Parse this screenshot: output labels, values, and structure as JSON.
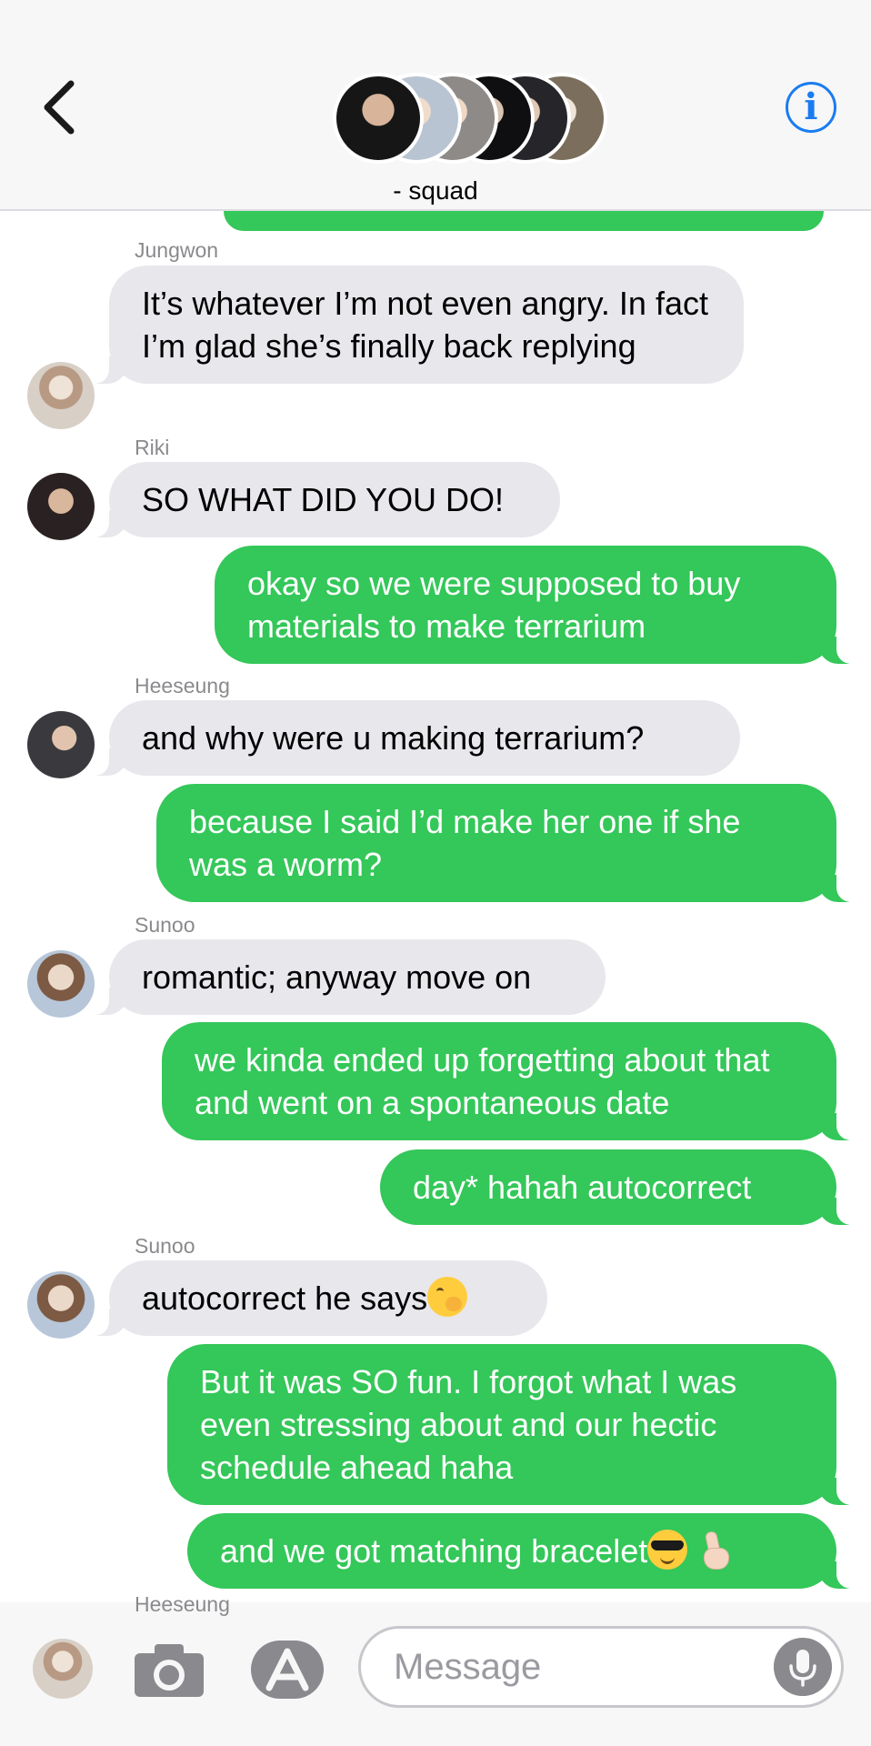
{
  "header": {
    "group_name": "- squad",
    "back_label": "Back",
    "info_label": "i"
  },
  "messages": {
    "m1": {
      "sender": "Jungwon",
      "text": "It’s whatever I’m not even angry. In fact I’m glad she’s finally back replying"
    },
    "m2": {
      "sender": "Riki",
      "text": "SO WHAT DID YOU DO!"
    },
    "m3": {
      "text": "okay so we were supposed to buy materials to make terrarium"
    },
    "m4": {
      "sender": "Heeseung",
      "text": "and why were u making terrarium?"
    },
    "m5": {
      "text": "because I said I’d make her one if she was a worm?"
    },
    "m6": {
      "sender": "Sunoo",
      "text": "romantic; anyway move on"
    },
    "m7": {
      "text": "we kinda ended up forgetting about that and went on a spontaneous date"
    },
    "m8": {
      "text": "day* hahah autocorrect"
    },
    "m9": {
      "sender": "Sunoo",
      "text": "autocorrect he says",
      "emoji": "face-with-hand-over-mouth"
    },
    "m10": {
      "text": "But it was SO fun. I forgot what I was even stressing about and our hectic schedule ahead haha"
    },
    "m11": {
      "text": "and we got matching bracelet",
      "emoji": "smiling-face-with-sunglasses, crossed-fingers"
    },
    "next_sender_peek": "Heeseung"
  },
  "composer": {
    "placeholder": "Message"
  },
  "colors": {
    "outgoing": "#34c759",
    "incoming": "#e8e7ec",
    "info_blue": "#1a7cf0"
  },
  "icons": [
    "back-chevron-icon",
    "info-icon",
    "camera-icon",
    "app-store-icon",
    "microphone-icon"
  ]
}
